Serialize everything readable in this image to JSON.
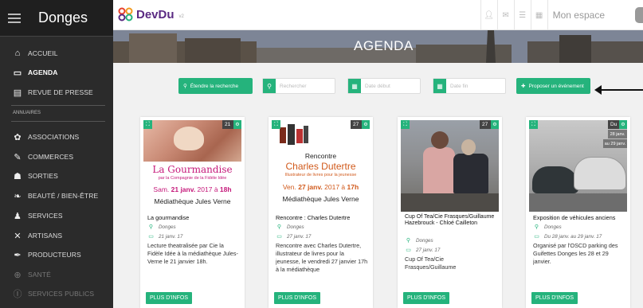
{
  "sidebar": {
    "title": "Donges",
    "items": [
      {
        "label": "ACCUEIL",
        "icon": "home-icon"
      },
      {
        "label": "AGENDA",
        "icon": "calendar-icon"
      },
      {
        "label": "REVUE DE PRESSE",
        "icon": "newspaper-icon"
      },
      {
        "label": "ASSOCIATIONS",
        "icon": "cog-icon"
      },
      {
        "label": "COMMERCES",
        "icon": "cart-icon"
      },
      {
        "label": "SORTIES",
        "icon": "person-icon"
      },
      {
        "label": "BEAUTÉ / BIEN-ÊTRE",
        "icon": "leaf-icon"
      },
      {
        "label": "SERVICES",
        "icon": "user-group-icon"
      },
      {
        "label": "ARTISANS",
        "icon": "tools-icon"
      },
      {
        "label": "PRODUCTEURS",
        "icon": "pen-icon"
      },
      {
        "label": "SANTÉ",
        "icon": "plus-circle-icon"
      },
      {
        "label": "SERVICES PUBLICS",
        "icon": "info-icon"
      }
    ],
    "section_label": "ANNUAIRES"
  },
  "topbar": {
    "logo_text": "DevDu",
    "logo_sub": "v2",
    "space_label": "Mon espace"
  },
  "banner": {
    "title": "AGENDA"
  },
  "filters": {
    "extend_label": "Étendre la recherche",
    "search_placeholder": "Rechercher",
    "date_start_placeholder": "Date début",
    "date_end_placeholder": "Date fin",
    "propose_label": "Proposer un événement"
  },
  "colors": {
    "accent": "#25b37c",
    "sidebar": "#2b2b2b"
  },
  "cards": [
    {
      "badge": "21",
      "title": "La gourmandise",
      "location": "Donges",
      "date": "21 janv. 17",
      "desc": "Lecture theatralisée par Cie la Fidèle Idée à la médiathèque Jules-Verne le 21 janvier 18h.",
      "more": "PLUS D'INFOS",
      "poster": {
        "title": "La Gourmandise",
        "sub": "par la Compagnie de la Fidèle Idée",
        "line_pre": "Sam. ",
        "line_bold": "21 janv.",
        "line_mid": " 2017 à ",
        "line_bold2": "18h",
        "loc": "Médiathèque Jules Verne"
      }
    },
    {
      "badge": "27",
      "title": "Rencontre : Charles Dutertre",
      "location": "Donges",
      "date": "27 janv. 17",
      "desc": "Rencontre avec Charles Dutertre, illustrateur de livres pour la jeunesse, le vendredi 27 janvier 17h à la médiathèque",
      "more": "PLUS D'INFOS",
      "poster": {
        "r": "Rencontre",
        "name": "Charles Dutertre",
        "sub": "Illustrateur de livres pour la jeunesse",
        "date_pre": "Ven. ",
        "date_bold": "27 janv.",
        "date_mid": " 2017 à ",
        "date_bold2": "17h",
        "loc": "Médiathèque Jules Verne"
      }
    },
    {
      "badge": "27",
      "title": "Cup Of Tea/Cie Frasques/Guillaume Hazebrouck - Chloé Cailleton",
      "location": "Donges",
      "date": "27 janv. 17",
      "desc": "Cup Of Tea/Cie Frasques/Guillaume",
      "more": "PLUS D'INFOS"
    },
    {
      "badge": "Du",
      "sub1": "28 janv.",
      "sub2": "au 29 janv.",
      "title": "Exposition de véhicules anciens",
      "location": "Donges",
      "date": "Du 28 janv. au 29 janv. 17",
      "desc": "Organisé par l'OSCD parking des Guifettes Donges les 28 et 29 janvier.",
      "more": "PLUS D'INFOS"
    }
  ]
}
